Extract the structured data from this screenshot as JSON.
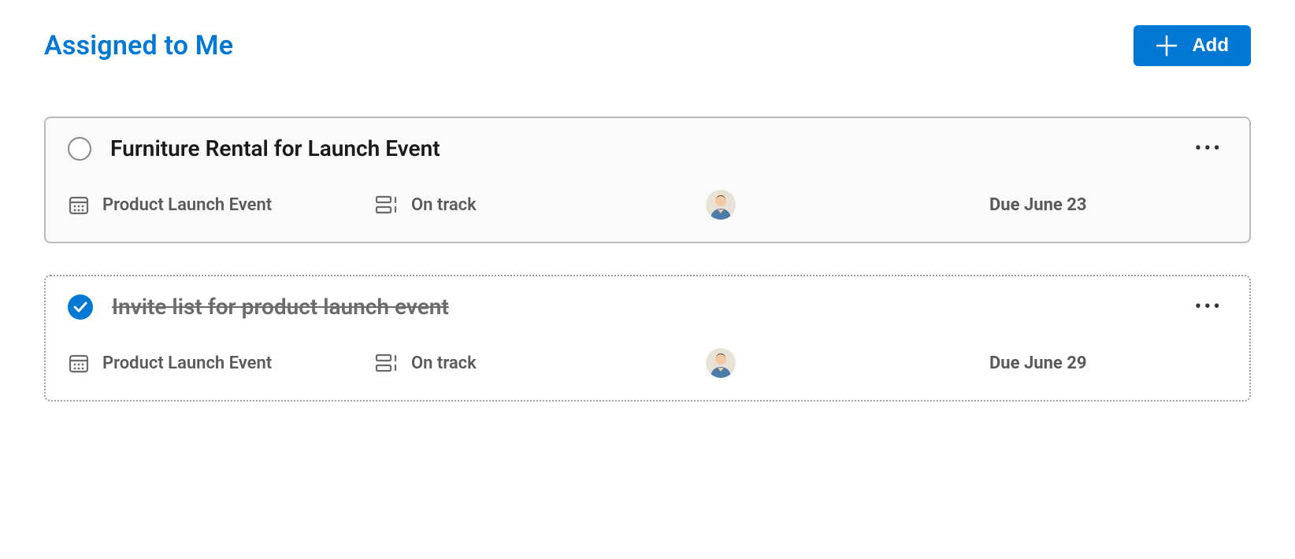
{
  "header": {
    "title": "Assigned to Me",
    "add_label": "Add"
  },
  "tasks": [
    {
      "title": "Furniture Rental for Launch Event",
      "completed": false,
      "project": "Product Launch Event",
      "status": "On track",
      "due": "Due June 23"
    },
    {
      "title": "Invite list for product launch event",
      "completed": true,
      "project": "Product Launch Event",
      "status": "On track",
      "due": "Due June 29"
    }
  ]
}
